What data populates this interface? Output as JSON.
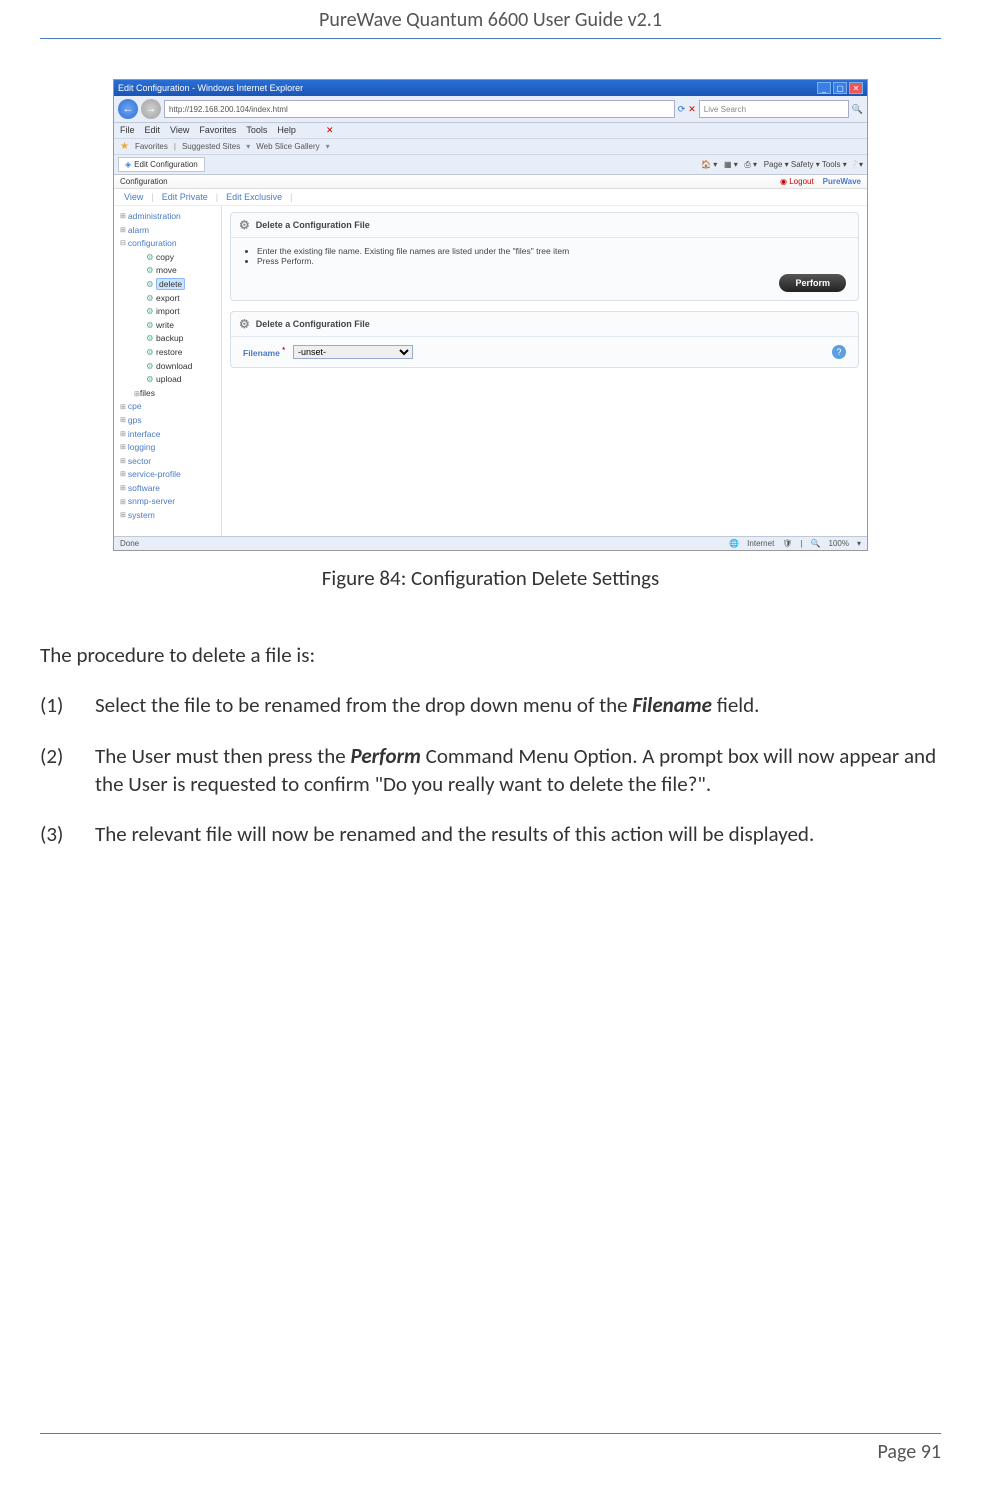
{
  "header": {
    "title": "PureWave Quantum 6600 User Guide v2.1"
  },
  "ie": {
    "title_text": "Edit Configuration - Windows Internet Explorer",
    "address": "http://192.168.200.104/index.html",
    "search_placeholder": "Live Search",
    "menu": [
      "File",
      "Edit",
      "View",
      "Favorites",
      "Tools",
      "Help"
    ],
    "favorites_label": "Favorites",
    "suggested_sites": "Suggested Sites",
    "web_slice": "Web Slice Gallery",
    "tab_label": "Edit Configuration",
    "toolbar_items": "Page ▾  Safety ▾  Tools ▾",
    "status_left": "Done",
    "status_internet": "Internet",
    "status_zoom": "100%"
  },
  "app": {
    "top_left": "Configuration",
    "logout": "Logout",
    "brand": "PureWave",
    "tabs": {
      "view": "View",
      "edit_private": "Edit Private",
      "edit_exclusive": "Edit Exclusive"
    }
  },
  "tree": {
    "items_top": [
      "administration",
      "alarm",
      "configuration"
    ],
    "config_children": [
      "copy",
      "move",
      "delete",
      "export",
      "import",
      "write",
      "backup",
      "restore",
      "download",
      "upload",
      "files"
    ],
    "items_bottom": [
      "cpe",
      "gps",
      "interface",
      "logging",
      "sector",
      "service-profile",
      "software",
      "snmp-server",
      "system"
    ]
  },
  "card1": {
    "title": "Delete a Configuration File",
    "bullet1": "Enter the existing file name. Existing file names are listed under the \"files\" tree item",
    "bullet2": "Press Perform.",
    "button": "Perform"
  },
  "card2": {
    "title": "Delete a Configuration File",
    "filename_label": "Filename",
    "filename_value": "-unset-"
  },
  "figure": {
    "caption": "Figure 84: Configuration Delete Settings"
  },
  "text": {
    "intro": "The procedure to delete a file is:",
    "step1_num": "(1)",
    "step1_a": "Select the file to be renamed from the drop down menu of the ",
    "step1_bold": "Filename",
    "step1_b": " field.",
    "step2_num": "(2)",
    "step2_a": "The User must then press the ",
    "step2_bold": "Perform",
    "step2_b": " Command Menu Option. A prompt box will now appear and the User is requested to confirm \"Do you really want to delete the file?\".",
    "step3_num": "(3)",
    "step3": "The relevant file will now be renamed and the results of this action will be displayed."
  },
  "footer": {
    "page": "Page 91"
  }
}
